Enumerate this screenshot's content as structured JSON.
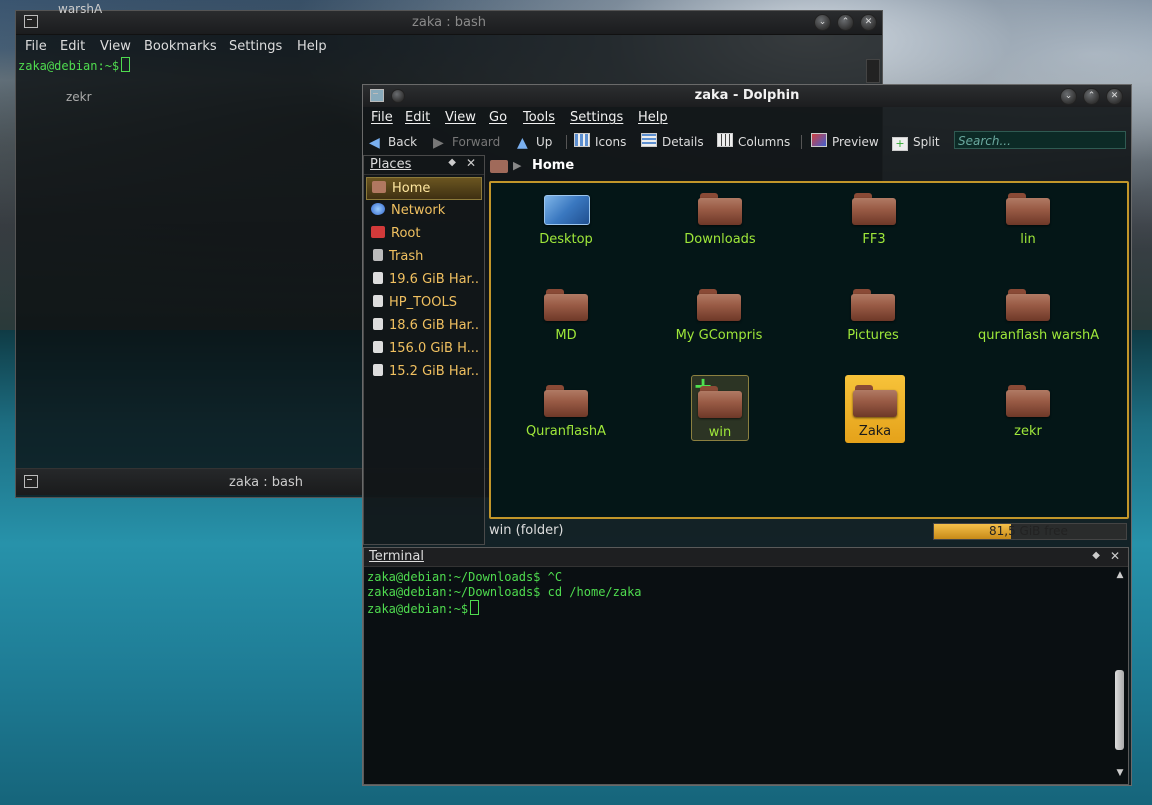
{
  "konsole": {
    "title": "zaka : bash",
    "menu": [
      "File",
      "Edit",
      "View",
      "Bookmarks",
      "Settings",
      "Help"
    ],
    "prompt": "zaka@debian:~$",
    "bg_text_1": "warshA",
    "bg_text_2": "zekr",
    "bottom_title": "zaka : bash"
  },
  "dolphin": {
    "title": "zaka - Dolphin",
    "menu": [
      "File",
      "Edit",
      "View",
      "Go",
      "Tools",
      "Settings",
      "Help"
    ],
    "toolbar": {
      "back": "Back",
      "forward": "Forward",
      "up": "Up",
      "icons": "Icons",
      "details": "Details",
      "columns": "Columns",
      "preview": "Preview",
      "split": "Split",
      "search_placeholder": "Search..."
    },
    "places": {
      "title": "Places",
      "items": [
        {
          "label": "Home",
          "icon": "home-icon"
        },
        {
          "label": "Network",
          "icon": "network-icon"
        },
        {
          "label": "Root",
          "icon": "root-folder-icon"
        },
        {
          "label": "Trash",
          "icon": "trash-icon"
        },
        {
          "label": "19.6 GiB Har...",
          "icon": "harddisk-icon"
        },
        {
          "label": "HP_TOOLS",
          "icon": "harddisk-icon"
        },
        {
          "label": "18.6 GiB Har...",
          "icon": "harddisk-icon"
        },
        {
          "label": "156.0 GiB H...",
          "icon": "harddisk-icon"
        },
        {
          "label": "15.2 GiB Har...",
          "icon": "harddisk-icon"
        }
      ]
    },
    "breadcrumb": "Home",
    "files": [
      {
        "label": "Desktop"
      },
      {
        "label": "Downloads"
      },
      {
        "label": "FF3"
      },
      {
        "label": "lin"
      },
      {
        "label": "MD"
      },
      {
        "label": "My GCompris"
      },
      {
        "label": "Pictures"
      },
      {
        "label": "quranflash warshA"
      },
      {
        "label": "QuranflashA"
      },
      {
        "label": "win"
      },
      {
        "label": "Zaka"
      },
      {
        "label": "zekr"
      }
    ],
    "status": "win (folder)",
    "free_space": "81,5 GiB free",
    "capacity_fraction": 0.4,
    "terminal": {
      "title": "Terminal",
      "lines": [
        "zaka@debian:~/Downloads$ ^C",
        "zaka@debian:~/Downloads$ cd /home/zaka",
        "zaka@debian:~$"
      ]
    }
  }
}
